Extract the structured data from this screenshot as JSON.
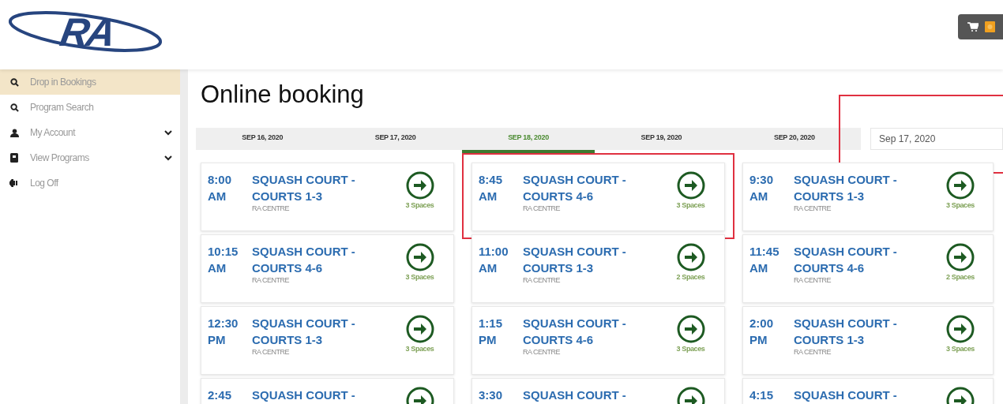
{
  "header": {
    "logo": "RA"
  },
  "sidebar": {
    "items": [
      {
        "label": "Drop in Bookings",
        "kind": "search",
        "selected": true,
        "expandable": false
      },
      {
        "label": "Program Search",
        "kind": "search",
        "selected": false,
        "expandable": false
      },
      {
        "label": "My Account",
        "kind": "user",
        "selected": false,
        "expandable": true
      },
      {
        "label": "View Programs",
        "kind": "book",
        "selected": false,
        "expandable": true
      },
      {
        "label": "Log Off",
        "kind": "logout",
        "selected": false,
        "expandable": false
      }
    ]
  },
  "page_title": "Online booking",
  "date_tabs": [
    {
      "label": "SEP 16, 2020",
      "selected": false
    },
    {
      "label": "SEP 17, 2020",
      "selected": false
    },
    {
      "label": "SEP 18, 2020",
      "selected": true
    },
    {
      "label": "SEP 19, 2020",
      "selected": false
    },
    {
      "label": "SEP 20, 2020",
      "selected": false
    }
  ],
  "date_field": {
    "value": "Sep 17, 2020",
    "highlighted": true
  },
  "sessions": [
    {
      "time": "8:00",
      "period": "AM",
      "title": "SQUASH COURT - COURTS 1-3",
      "location": "RA CENTRE",
      "spaces": "3 Spaces",
      "highlighted": false
    },
    {
      "time": "8:45",
      "period": "AM",
      "title": "SQUASH COURT - COURTS 4-6",
      "location": "RA CENTRE",
      "spaces": "3 Spaces",
      "highlighted": true
    },
    {
      "time": "9:30",
      "period": "AM",
      "title": "SQUASH COURT - COURTS 1-3",
      "location": "RA CENTRE",
      "spaces": "3 Spaces",
      "highlighted": false
    },
    {
      "time": "10:15",
      "period": "AM",
      "title": "SQUASH COURT - COURTS 4-6",
      "location": "RA CENTRE",
      "spaces": "3 Spaces",
      "highlighted": false
    },
    {
      "time": "11:00",
      "period": "AM",
      "title": "SQUASH COURT - COURTS 1-3",
      "location": "RA CENTRE",
      "spaces": "2 Spaces",
      "highlighted": false
    },
    {
      "time": "11:45",
      "period": "AM",
      "title": "SQUASH COURT - COURTS 4-6",
      "location": "RA CENTRE",
      "spaces": "2 Spaces",
      "highlighted": false
    },
    {
      "time": "12:30",
      "period": "PM",
      "title": "SQUASH COURT - COURTS 1-3",
      "location": "RA CENTRE",
      "spaces": "3 Spaces",
      "highlighted": false
    },
    {
      "time": "1:15",
      "period": "PM",
      "title": "SQUASH COURT - COURTS 4-6",
      "location": "RA CENTRE",
      "spaces": "3 Spaces",
      "highlighted": false
    },
    {
      "time": "2:00",
      "period": "PM",
      "title": "SQUASH COURT - COURTS 1-3",
      "location": "RA CENTRE",
      "spaces": "3 Spaces",
      "highlighted": false
    },
    {
      "time": "2:45",
      "title": "SQUASH COURT -",
      "highlighted": false
    },
    {
      "time": "3:30",
      "title": "SQUASH COURT -",
      "highlighted": false
    },
    {
      "time": "4:15",
      "title": "SQUASH COURT -",
      "highlighted": false
    }
  ]
}
